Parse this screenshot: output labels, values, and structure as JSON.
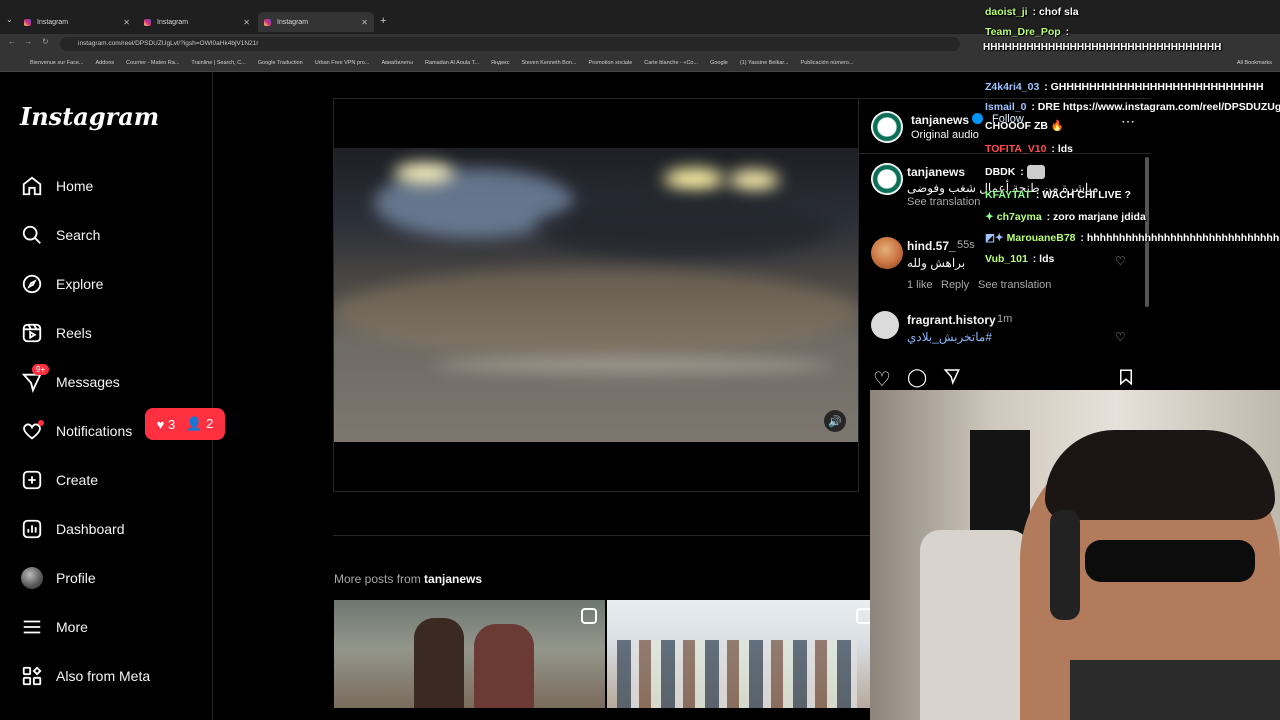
{
  "browser": {
    "tabs": [
      {
        "title": "Instagram"
      },
      {
        "title": "Instagram"
      },
      {
        "title": "Instagram"
      }
    ],
    "url": "instagram.com/reel/DPSDUZUgLvl/?igsh=OWI0aHk4bjV1N21r",
    "bookmarks": [
      "Bienvenue sur Face...",
      "Addons",
      "Courrier - Mateo Ra...",
      "Trainline | Search, C...",
      "Google Traduction",
      "Urban Free VPN pro...",
      "Авиабилеты",
      "Ramadan Al Aoula T...",
      "Яндекс",
      "Steven Kenneth Bon...",
      "Promotion sociale",
      "Carte blanche - «Co...",
      "Google",
      "(1) Yassine Belkar...",
      "Publicación número...",
      "All Bookmarks"
    ]
  },
  "sidebar": {
    "logo": "Instagram",
    "items": [
      {
        "label": "Home",
        "icon": "home-icon"
      },
      {
        "label": "Search",
        "icon": "search-icon"
      },
      {
        "label": "Explore",
        "icon": "compass-icon"
      },
      {
        "label": "Reels",
        "icon": "reels-icon"
      },
      {
        "label": "Messages",
        "icon": "messenger-icon",
        "badge": "9+"
      },
      {
        "label": "Notifications",
        "icon": "heart-icon"
      },
      {
        "label": "Create",
        "icon": "plus-square-icon"
      },
      {
        "label": "Dashboard",
        "icon": "dashboard-icon"
      },
      {
        "label": "Profile",
        "icon": "avatar-icon"
      },
      {
        "label": "More",
        "icon": "hamburger-icon"
      },
      {
        "label": "Also from Meta",
        "icon": "meta-grid-icon"
      }
    ],
    "notif_pill": {
      "likes": "3",
      "follows": "2"
    }
  },
  "post": {
    "author": "tanjanews",
    "audio": "Original audio",
    "follow": "Follow",
    "caption_user": "tanjanews",
    "caption": "مباشرة من طنجة أعمال شغب وفوضى",
    "see_translation": "See translation",
    "comments": [
      {
        "user": "hind.57_",
        "time": "55s",
        "text": "براهش ولله",
        "likes": "1 like",
        "reply": "Reply",
        "translate": "See translation"
      },
      {
        "user": "fragrant.history",
        "time": "1m",
        "text": "#ماتخربش_بلادي"
      }
    ],
    "more_posts_prefix": "More posts from ",
    "more_posts_user": "tanjanews"
  },
  "chat": [
    {
      "user": "daoist_ji",
      "color": "#ffffff",
      "msg": "chof sla"
    },
    {
      "user": "Team_Dre_Pop",
      "color": "#ffffff",
      "msg": "HHHHHHHHHHHHHHHHHHHHHHHHHHHHHHHHH"
    },
    {
      "user": "Z4k4ri4_03",
      "color": "#9ec3ff",
      "msg": "GHHHHHHHHHHHHHHHHHHHHHHHHHHH"
    },
    {
      "user": "Ismail_0",
      "color": "#9ec3ff",
      "msg": "DRE https://www.instagram.com/reel/DPSDUZUg"
    },
    {
      "user": "",
      "color": "#ffffff",
      "msg": "CHOOOF ZB 🔥"
    },
    {
      "user": "TOFITA_V10",
      "color": "#ff4d4d",
      "msg": "lds"
    },
    {
      "user": "DBDK",
      "color": "#ffffff",
      "msg": ""
    },
    {
      "user": "KFAYTAT",
      "color": "#8fff8f",
      "msg": "WACH CHI LIVE ?"
    },
    {
      "user": "ch7ayma",
      "color": "#b9ff7a",
      "msg": "zoro marjane jdida"
    },
    {
      "user": "MarouaneB78",
      "color": "#b9ff7a",
      "msg": "hhhhhhhhhhhhhhhhhhhhhhhhhhhhhhh"
    },
    {
      "user": "Vub_101",
      "color": "#b9ff7a",
      "msg": "lds"
    }
  ],
  "colors": {
    "badge": "#ff3040",
    "link": "#e0f1ff",
    "muted": "#a8a8a8"
  }
}
